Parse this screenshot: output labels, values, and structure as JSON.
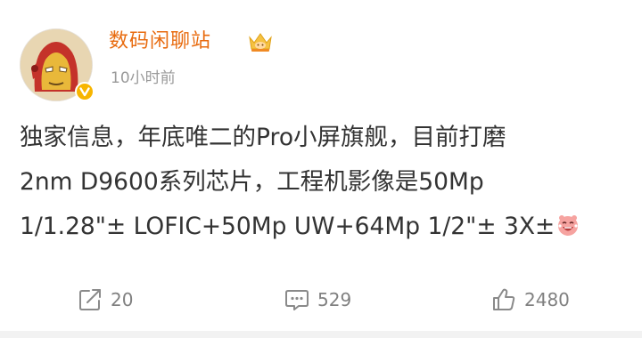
{
  "post": {
    "author": {
      "name": "数码闲聊站",
      "verified_badge": "verified-badge",
      "member_badge": "crown-badge"
    },
    "timestamp": "10小时前",
    "text_lines": [
      "独家信息，年底唯二的Pro小屏旗舰，目前打磨",
      "2nm D9600系列芯片，工程机影像是50Mp",
      "1/1.28\"± LOFIC+50Mp UW+64Mp 1/2\"± 3X±"
    ],
    "trailing_emoji": "laughing-face-emoji"
  },
  "actions": {
    "repost": {
      "icon": "repost-icon",
      "count": "20"
    },
    "comment": {
      "icon": "comment-icon",
      "count": "529"
    },
    "like": {
      "icon": "thumbs-up-icon",
      "count": "2480"
    }
  },
  "colors": {
    "username": "#e86b0f",
    "body_text": "#333333",
    "meta_text": "#9a9a9a",
    "action_text": "#808080",
    "verified": "#f7b500"
  }
}
